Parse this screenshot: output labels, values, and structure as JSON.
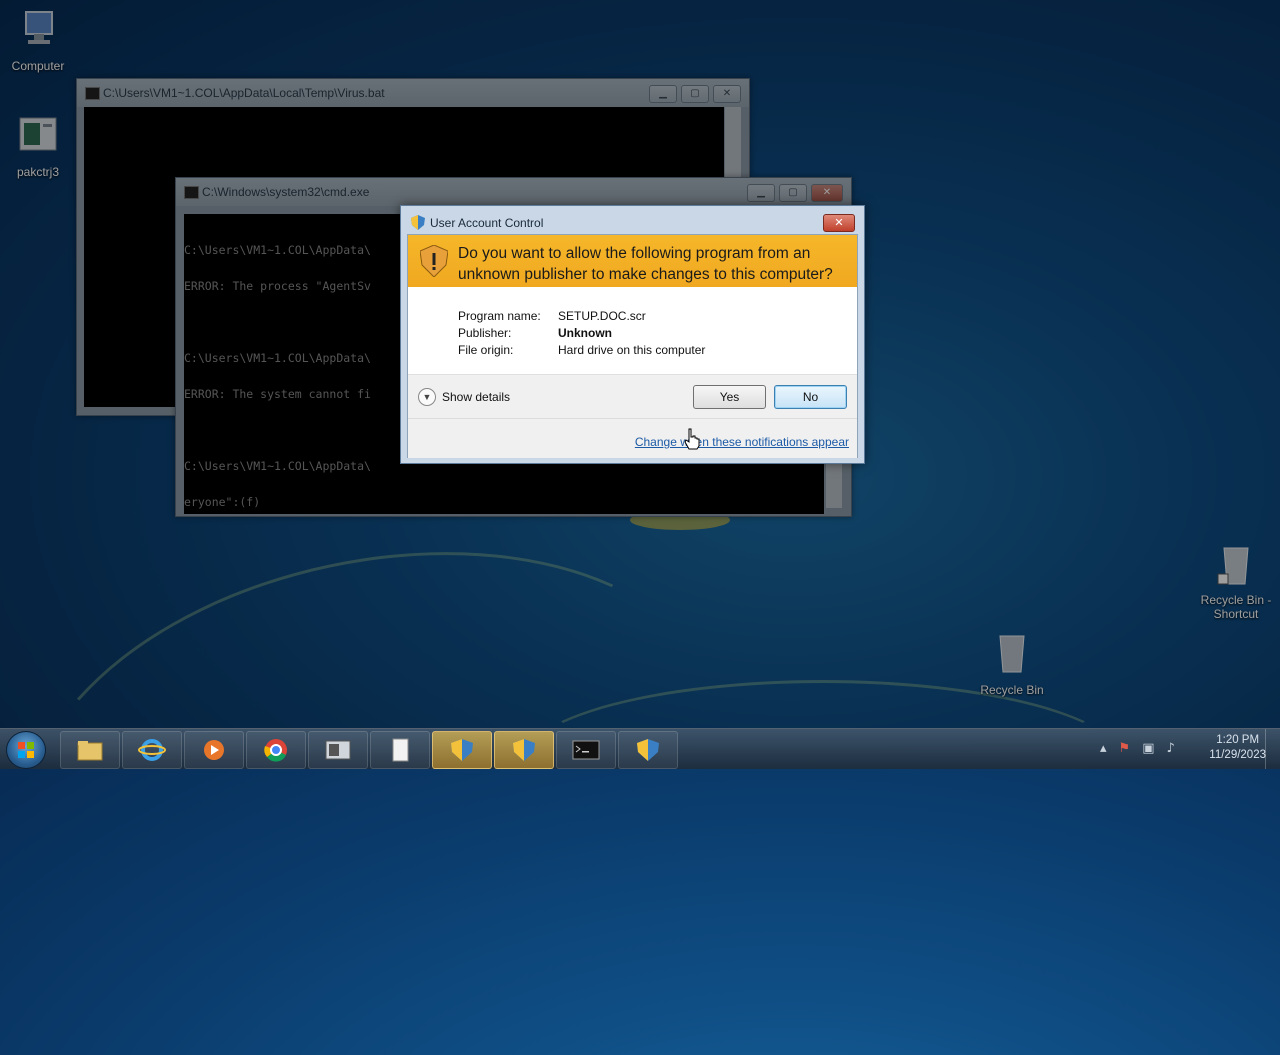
{
  "desktop": {
    "icons": [
      {
        "label": "Computer"
      },
      {
        "label": "pakctrj3"
      },
      {
        "label": "Recycle Bin -\nShortcut"
      },
      {
        "label": "Recycle Bin"
      }
    ]
  },
  "virus_window": {
    "title": "C:\\Users\\VM1~1.COL\\AppData\\Local\\Temp\\Virus.bat"
  },
  "cmd_window": {
    "title": "C:\\Windows\\system32\\cmd.exe",
    "lines": [
      "C:\\Users\\VM1~1.COL\\AppData\\",
      "ERROR: The process \"AgentSv",
      "",
      "C:\\Users\\VM1~1.COL\\AppData\\",
      "ERROR: The system cannot fi",
      "",
      "C:\\Users\\VM1~1.COL\\AppData\\",
      "eryone\":(f)"
    ]
  },
  "uac": {
    "title": "User Account Control",
    "question": "Do you want to allow the following program from an unknown publisher to make changes to this computer?",
    "program_label": "Program name:",
    "program_value": "SETUP.DOC.scr",
    "publisher_label": "Publisher:",
    "publisher_value": "Unknown",
    "origin_label": "File origin:",
    "origin_value": "Hard drive on this computer",
    "details_label": "Show details",
    "yes_label": "Yes",
    "no_label": "No",
    "change_link": "Change when these notifications appear",
    "close_glyph": "✕"
  },
  "taskbar": {
    "time": "1:20 PM",
    "date": "11/29/2023",
    "items": [
      "explorer",
      "internet-explorer",
      "media-player",
      "chrome",
      "window",
      "document",
      "uac-shield",
      "uac-shield",
      "cmd",
      "uac-shield"
    ]
  },
  "colors": {
    "uac_banner": "#f0a820",
    "link": "#1c5aa6",
    "desktop": "#0f4f86"
  }
}
